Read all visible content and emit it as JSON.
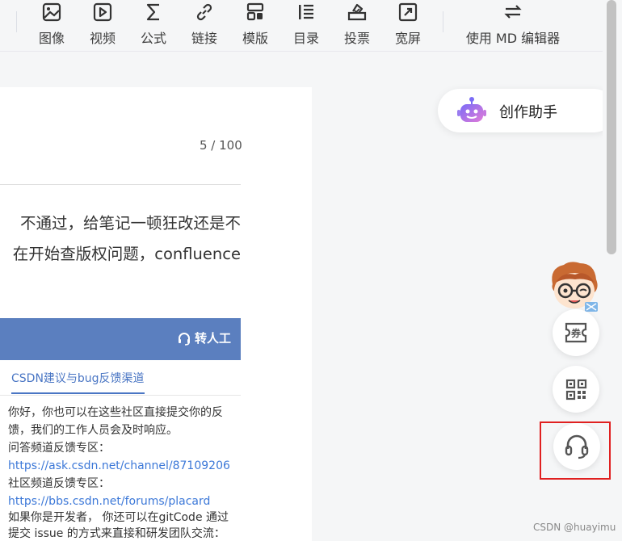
{
  "toolbar": {
    "items": [
      {
        "label": "图像",
        "icon": "image-icon"
      },
      {
        "label": "视频",
        "icon": "video-icon"
      },
      {
        "label": "公式",
        "icon": "formula-icon"
      },
      {
        "label": "链接",
        "icon": "link-icon"
      },
      {
        "label": "模版",
        "icon": "template-icon"
      },
      {
        "label": "目录",
        "icon": "toc-icon"
      },
      {
        "label": "投票",
        "icon": "vote-icon"
      },
      {
        "label": "宽屏",
        "icon": "widescreen-icon"
      }
    ],
    "md_switch": {
      "label": "使用 MD 编辑器",
      "icon": "switch-arrows-icon"
    }
  },
  "editor": {
    "title_counter": "5 / 100",
    "paragraph_line1": "不通过，给笔记一顿狂改还是不",
    "paragraph_line2": "在开始查版权问题，confluence"
  },
  "embedded": {
    "transfer_label": "转人工",
    "tab_label": "CSDN建议与bug反馈渠道",
    "messages": [
      {
        "text": "你好，你也可以在这些社区直接提交你的反",
        "link": false
      },
      {
        "text": "馈，我们的工作人员会及时响应。",
        "link": false
      },
      {
        "text": "问答频道反馈专区：",
        "link": false
      },
      {
        "text": "https://ask.csdn.net/channel/87109206",
        "link": true
      },
      {
        "text": "社区频道反馈专区：",
        "link": false
      },
      {
        "text": "https://bbs.csdn.net/forums/placard",
        "link": true
      },
      {
        "text": "如果你是开发者， 你还可以在gitCode 通过",
        "link": false
      },
      {
        "text": "提交 issue 的方式来直接和研发团队交流：",
        "link": false
      }
    ]
  },
  "sidebar": {
    "assistant_label": "创作助手",
    "coupon_label": "券"
  },
  "watermark": "CSDN @huayimu",
  "colors": {
    "accent": "#5b7fbf",
    "link": "#3c78d8",
    "highlight": "#e02020"
  }
}
